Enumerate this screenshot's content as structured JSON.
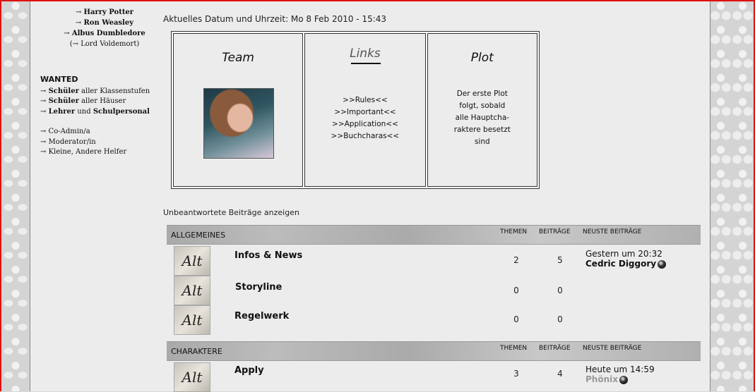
{
  "sidebar": {
    "characters": [
      {
        "arrow": "→",
        "name": "Harry Potter"
      },
      {
        "arrow": "→",
        "name": "Ron Weasley"
      },
      {
        "arrow": "→",
        "name": "Albus Dumbledore"
      },
      {
        "text": "(→ Lord Voldemort)"
      }
    ],
    "wanted_title": "WANTED",
    "wanted": [
      {
        "bold": "Schüler",
        "rest": "aller Klassenstufen"
      },
      {
        "bold": "Schüler",
        "rest": "aller Häuser"
      },
      {
        "bold": "Lehrer",
        "mid": "und",
        "bold2": "Schulpersonal"
      }
    ],
    "wanted_staff": [
      "→ Co-Admin/a",
      "→ Moderator/in",
      "→ Kleine, Andere Helfer"
    ]
  },
  "datetime": "Aktuelles Datum und Uhrzeit: Mo 8 Feb 2010 - 15:43",
  "boxes": {
    "team_title": "Team",
    "links_title": "Links",
    "links": [
      ">>Rules<<",
      ">>Important<<",
      ">>Application<<",
      ">>Buchcharas<<"
    ],
    "plot_title": "Plot",
    "plot_lines": [
      "Der erste Plot",
      "folgt, sobald",
      "alle Hauptcha-",
      "raktere besetzt",
      "sind"
    ]
  },
  "unanswered": "Unbeantwortete Beiträge anzeigen",
  "columns": {
    "topics": "THEMEN",
    "posts": "BEITRÄGE",
    "latest": "NEUSTE BEITRÄGE"
  },
  "categories": [
    {
      "name": "ALLGEMEINES",
      "forums": [
        {
          "icon": "Alt",
          "name": "Infos & News",
          "topics": "2",
          "posts": "5",
          "last_time": "Gestern um 20:32",
          "last_user": "Cedric Diggory"
        },
        {
          "icon": "Alt",
          "name": "Storyline",
          "topics": "0",
          "posts": "0"
        },
        {
          "icon": "Alt",
          "name": "Regelwerk",
          "topics": "0",
          "posts": "0"
        }
      ]
    },
    {
      "name": "CHARAKTERE",
      "forums": [
        {
          "icon": "Alt",
          "name": "Apply",
          "topics": "3",
          "posts": "4",
          "last_time": "Heute um 14:59",
          "last_user": "Phönix"
        }
      ]
    }
  ],
  "colors": {
    "frame": "#e01010",
    "content_bg": "#ececec",
    "category_bar": "#b4b4b4"
  }
}
